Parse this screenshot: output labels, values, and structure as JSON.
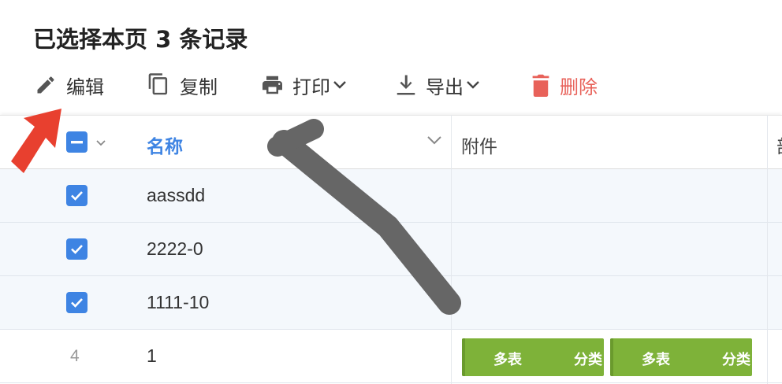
{
  "selection": {
    "title": "已选择本页 3 条记录"
  },
  "toolbar": {
    "edit_label": "编辑",
    "copy_label": "复制",
    "print_label": "打印",
    "export_label": "导出",
    "delete_label": "删除"
  },
  "table": {
    "columns": {
      "name": "名称",
      "attachment": "附件",
      "next": "部"
    },
    "rows": [
      {
        "name": "aassdd",
        "checked": true
      },
      {
        "name": "2222-0",
        "checked": true
      },
      {
        "name": "1111-10",
        "checked": true
      },
      {
        "index": "4",
        "name": "1",
        "checked": false,
        "attachments": [
          {
            "text": "多表",
            "suffix": "分类"
          },
          {
            "text": "多表",
            "suffix": "分类"
          }
        ]
      }
    ]
  },
  "colors": {
    "accent": "#3e84e3",
    "danger": "#e8625a",
    "chip": "#7eb239",
    "annotation_arrow": "#e8402f",
    "annotation_stroke": "#666666"
  }
}
